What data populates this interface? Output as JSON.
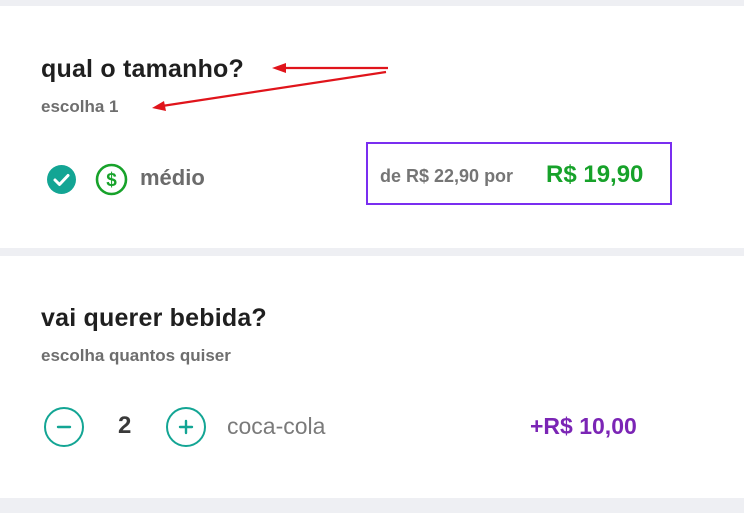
{
  "size_section": {
    "title": "qual o tamanho?",
    "subtitle": "escolha 1",
    "option": {
      "label": "médio",
      "icon": "dollar-circle-icon",
      "selected": true,
      "old_price_text": "de R$ 22,90 por",
      "new_price": "R$ 19,90"
    }
  },
  "drink_section": {
    "title": "vai querer bebida?",
    "subtitle": "escolha quantos quiser",
    "option": {
      "quantity": "2",
      "label": "coca-cola",
      "price": "+R$ 10,00"
    }
  },
  "colors": {
    "accent_teal": "#13a594",
    "price_green": "#17a22a",
    "highlight_purple": "#7a2ef0",
    "extra_price_purple": "#7b25b5",
    "annotation_red": "#e0141b"
  }
}
